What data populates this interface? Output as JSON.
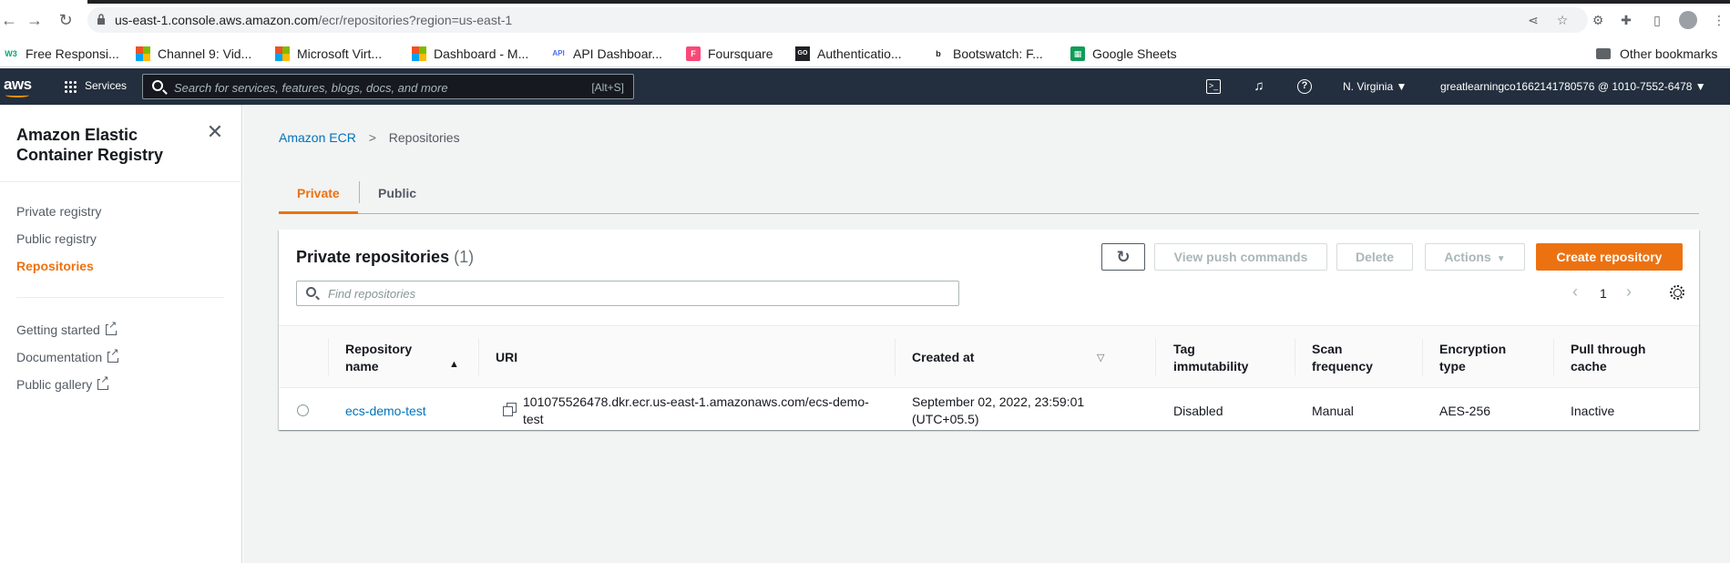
{
  "browser": {
    "url_host": "us-east-1.console.aws.amazon.com",
    "url_path": "/ecr/repositories?region=us-east-1",
    "bookmarks": [
      {
        "label": "Free Responsi...",
        "icon": "w3-icon"
      },
      {
        "label": "Channel 9: Vid...",
        "icon": "microsoft-icon"
      },
      {
        "label": "Microsoft Virt...",
        "icon": "microsoft-icon"
      },
      {
        "label": "Dashboard - M...",
        "icon": "microsoft-icon"
      },
      {
        "label": "API Dashboar...",
        "icon": "api-icon"
      },
      {
        "label": "Foursquare",
        "icon": "foursquare-icon"
      },
      {
        "label": "Authenticatio...",
        "icon": "go-icon"
      },
      {
        "label": "Bootswatch: F...",
        "icon": "bootswatch-icon"
      },
      {
        "label": "Google Sheets",
        "icon": "sheets-icon"
      }
    ],
    "other_bookmarks": "Other bookmarks"
  },
  "aws_header": {
    "logo": "aws",
    "services": "Services",
    "search_placeholder": "Search for services, features, blogs, docs, and more",
    "search_shortcut": "[Alt+S]",
    "region": "N. Virginia ▼",
    "account": "greatlearningco1662141780576 @ 1010-7552-6478 ▼"
  },
  "sidebar": {
    "title": "Amazon Elastic Container Registry",
    "items": [
      {
        "label": "Private registry",
        "active": false
      },
      {
        "label": "Public registry",
        "active": false
      },
      {
        "label": "Repositories",
        "active": true
      }
    ],
    "external_links": [
      {
        "label": "Getting started"
      },
      {
        "label": "Documentation"
      },
      {
        "label": "Public gallery"
      }
    ]
  },
  "breadcrumb": {
    "root": "Amazon ECR",
    "current": "Repositories"
  },
  "tabs": [
    {
      "label": "Private",
      "active": true
    },
    {
      "label": "Public",
      "active": false
    }
  ],
  "panel": {
    "title": "Private repositories",
    "count": "(1)",
    "buttons": {
      "view_push": "View push commands",
      "delete": "Delete",
      "actions": "Actions",
      "create": "Create repository"
    },
    "filter_placeholder": "Find repositories",
    "page": "1"
  },
  "table": {
    "columns": {
      "name_line1": "Repository",
      "name_line2": "name",
      "uri": "URI",
      "created": "Created at",
      "tag_line1": "Tag",
      "tag_line2": "immutability",
      "scan_line1": "Scan",
      "scan_line2": "frequency",
      "enc_line1": "Encryption",
      "enc_line2": "type",
      "pull_line1": "Pull through",
      "pull_line2": "cache"
    },
    "rows": [
      {
        "name": "ecs-demo-test",
        "uri_line1": "101075526478.dkr.ecr.us-east-1.amazonaws.com/ecs-demo-",
        "uri_line2": "test",
        "created_line1": "September 02, 2022, 23:59:01",
        "created_line2": "(UTC+05.5)",
        "tag_immutability": "Disabled",
        "scan_frequency": "Manual",
        "encryption_type": "AES-256",
        "pull_through_cache": "Inactive"
      }
    ]
  },
  "colors": {
    "aws_header": "#232f3e",
    "accent": "#ec7211",
    "link": "#0073bb"
  }
}
